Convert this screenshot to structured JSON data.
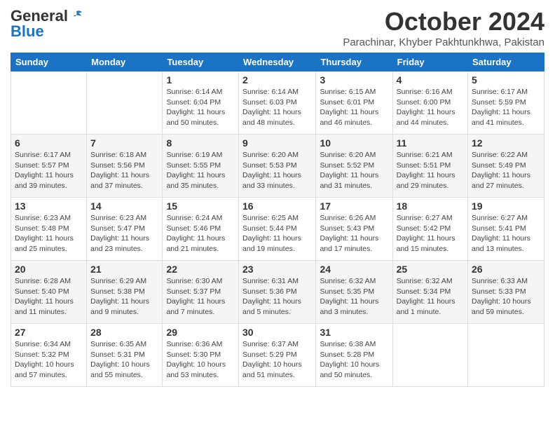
{
  "header": {
    "logo_line1": "General",
    "logo_line2": "Blue",
    "month_title": "October 2024",
    "subtitle": "Parachinar, Khyber Pakhtunkhwa, Pakistan"
  },
  "weekdays": [
    "Sunday",
    "Monday",
    "Tuesday",
    "Wednesday",
    "Thursday",
    "Friday",
    "Saturday"
  ],
  "weeks": [
    [
      {
        "day": "",
        "info": ""
      },
      {
        "day": "",
        "info": ""
      },
      {
        "day": "1",
        "info": "Sunrise: 6:14 AM\nSunset: 6:04 PM\nDaylight: 11 hours and 50 minutes."
      },
      {
        "day": "2",
        "info": "Sunrise: 6:14 AM\nSunset: 6:03 PM\nDaylight: 11 hours and 48 minutes."
      },
      {
        "day": "3",
        "info": "Sunrise: 6:15 AM\nSunset: 6:01 PM\nDaylight: 11 hours and 46 minutes."
      },
      {
        "day": "4",
        "info": "Sunrise: 6:16 AM\nSunset: 6:00 PM\nDaylight: 11 hours and 44 minutes."
      },
      {
        "day": "5",
        "info": "Sunrise: 6:17 AM\nSunset: 5:59 PM\nDaylight: 11 hours and 41 minutes."
      }
    ],
    [
      {
        "day": "6",
        "info": "Sunrise: 6:17 AM\nSunset: 5:57 PM\nDaylight: 11 hours and 39 minutes."
      },
      {
        "day": "7",
        "info": "Sunrise: 6:18 AM\nSunset: 5:56 PM\nDaylight: 11 hours and 37 minutes."
      },
      {
        "day": "8",
        "info": "Sunrise: 6:19 AM\nSunset: 5:55 PM\nDaylight: 11 hours and 35 minutes."
      },
      {
        "day": "9",
        "info": "Sunrise: 6:20 AM\nSunset: 5:53 PM\nDaylight: 11 hours and 33 minutes."
      },
      {
        "day": "10",
        "info": "Sunrise: 6:20 AM\nSunset: 5:52 PM\nDaylight: 11 hours and 31 minutes."
      },
      {
        "day": "11",
        "info": "Sunrise: 6:21 AM\nSunset: 5:51 PM\nDaylight: 11 hours and 29 minutes."
      },
      {
        "day": "12",
        "info": "Sunrise: 6:22 AM\nSunset: 5:49 PM\nDaylight: 11 hours and 27 minutes."
      }
    ],
    [
      {
        "day": "13",
        "info": "Sunrise: 6:23 AM\nSunset: 5:48 PM\nDaylight: 11 hours and 25 minutes."
      },
      {
        "day": "14",
        "info": "Sunrise: 6:23 AM\nSunset: 5:47 PM\nDaylight: 11 hours and 23 minutes."
      },
      {
        "day": "15",
        "info": "Sunrise: 6:24 AM\nSunset: 5:46 PM\nDaylight: 11 hours and 21 minutes."
      },
      {
        "day": "16",
        "info": "Sunrise: 6:25 AM\nSunset: 5:44 PM\nDaylight: 11 hours and 19 minutes."
      },
      {
        "day": "17",
        "info": "Sunrise: 6:26 AM\nSunset: 5:43 PM\nDaylight: 11 hours and 17 minutes."
      },
      {
        "day": "18",
        "info": "Sunrise: 6:27 AM\nSunset: 5:42 PM\nDaylight: 11 hours and 15 minutes."
      },
      {
        "day": "19",
        "info": "Sunrise: 6:27 AM\nSunset: 5:41 PM\nDaylight: 11 hours and 13 minutes."
      }
    ],
    [
      {
        "day": "20",
        "info": "Sunrise: 6:28 AM\nSunset: 5:40 PM\nDaylight: 11 hours and 11 minutes."
      },
      {
        "day": "21",
        "info": "Sunrise: 6:29 AM\nSunset: 5:38 PM\nDaylight: 11 hours and 9 minutes."
      },
      {
        "day": "22",
        "info": "Sunrise: 6:30 AM\nSunset: 5:37 PM\nDaylight: 11 hours and 7 minutes."
      },
      {
        "day": "23",
        "info": "Sunrise: 6:31 AM\nSunset: 5:36 PM\nDaylight: 11 hours and 5 minutes."
      },
      {
        "day": "24",
        "info": "Sunrise: 6:32 AM\nSunset: 5:35 PM\nDaylight: 11 hours and 3 minutes."
      },
      {
        "day": "25",
        "info": "Sunrise: 6:32 AM\nSunset: 5:34 PM\nDaylight: 11 hours and 1 minute."
      },
      {
        "day": "26",
        "info": "Sunrise: 6:33 AM\nSunset: 5:33 PM\nDaylight: 10 hours and 59 minutes."
      }
    ],
    [
      {
        "day": "27",
        "info": "Sunrise: 6:34 AM\nSunset: 5:32 PM\nDaylight: 10 hours and 57 minutes."
      },
      {
        "day": "28",
        "info": "Sunrise: 6:35 AM\nSunset: 5:31 PM\nDaylight: 10 hours and 55 minutes."
      },
      {
        "day": "29",
        "info": "Sunrise: 6:36 AM\nSunset: 5:30 PM\nDaylight: 10 hours and 53 minutes."
      },
      {
        "day": "30",
        "info": "Sunrise: 6:37 AM\nSunset: 5:29 PM\nDaylight: 10 hours and 51 minutes."
      },
      {
        "day": "31",
        "info": "Sunrise: 6:38 AM\nSunset: 5:28 PM\nDaylight: 10 hours and 50 minutes."
      },
      {
        "day": "",
        "info": ""
      },
      {
        "day": "",
        "info": ""
      }
    ]
  ]
}
